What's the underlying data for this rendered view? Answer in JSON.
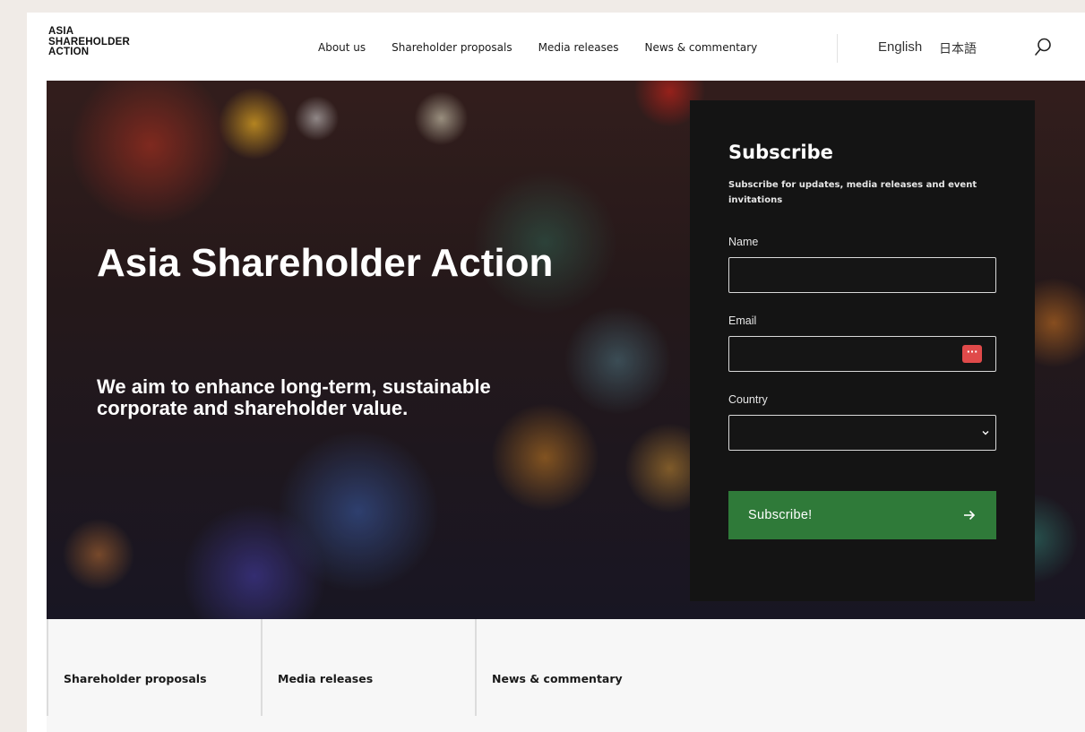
{
  "header": {
    "logo_lines": [
      "ASIA",
      "SHAREHOLDER",
      "ACTION"
    ],
    "nav": [
      {
        "label": "About us"
      },
      {
        "label": "Shareholder proposals"
      },
      {
        "label": "Media releases"
      },
      {
        "label": "News & commentary"
      }
    ],
    "lang_english": "English",
    "lang_japanese": "日本語",
    "search_icon": "search-icon"
  },
  "hero": {
    "title": "Asia Shareholder Action",
    "subtitle": "We aim to enhance long-term, sustainable corporate and shareholder value."
  },
  "subscribe": {
    "title": "Subscribe",
    "description": "Subscribe for updates, media releases and event invitations",
    "name_label": "Name",
    "name_value": "",
    "email_label": "Email",
    "email_value": "",
    "password_manager_icon": "password-manager-icon",
    "country_label": "Country",
    "country_value": "",
    "button_label": "Subscribe!",
    "button_icon": "arrow-right-icon",
    "button_color": "#2f7a39"
  },
  "tabs": [
    {
      "label": "Shareholder proposals"
    },
    {
      "label": "Media releases"
    },
    {
      "label": "News & commentary"
    }
  ]
}
